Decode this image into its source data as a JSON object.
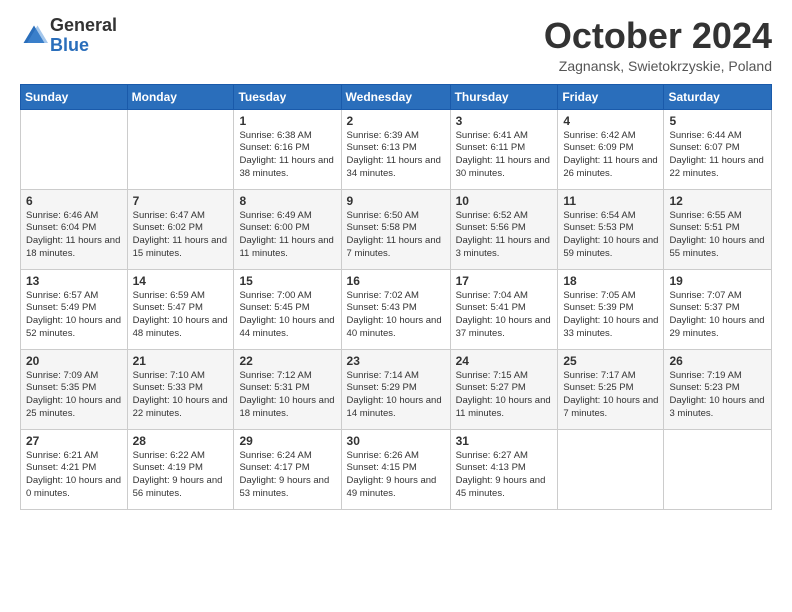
{
  "header": {
    "logo_general": "General",
    "logo_blue": "Blue",
    "month_title": "October 2024",
    "location": "Zagnansk, Swietokrzyskie, Poland"
  },
  "weekdays": [
    "Sunday",
    "Monday",
    "Tuesday",
    "Wednesday",
    "Thursday",
    "Friday",
    "Saturday"
  ],
  "weeks": [
    [
      {
        "day": "",
        "info": ""
      },
      {
        "day": "",
        "info": ""
      },
      {
        "day": "1",
        "info": "Sunrise: 6:38 AM\nSunset: 6:16 PM\nDaylight: 11 hours and 38 minutes."
      },
      {
        "day": "2",
        "info": "Sunrise: 6:39 AM\nSunset: 6:13 PM\nDaylight: 11 hours and 34 minutes."
      },
      {
        "day": "3",
        "info": "Sunrise: 6:41 AM\nSunset: 6:11 PM\nDaylight: 11 hours and 30 minutes."
      },
      {
        "day": "4",
        "info": "Sunrise: 6:42 AM\nSunset: 6:09 PM\nDaylight: 11 hours and 26 minutes."
      },
      {
        "day": "5",
        "info": "Sunrise: 6:44 AM\nSunset: 6:07 PM\nDaylight: 11 hours and 22 minutes."
      }
    ],
    [
      {
        "day": "6",
        "info": "Sunrise: 6:46 AM\nSunset: 6:04 PM\nDaylight: 11 hours and 18 minutes."
      },
      {
        "day": "7",
        "info": "Sunrise: 6:47 AM\nSunset: 6:02 PM\nDaylight: 11 hours and 15 minutes."
      },
      {
        "day": "8",
        "info": "Sunrise: 6:49 AM\nSunset: 6:00 PM\nDaylight: 11 hours and 11 minutes."
      },
      {
        "day": "9",
        "info": "Sunrise: 6:50 AM\nSunset: 5:58 PM\nDaylight: 11 hours and 7 minutes."
      },
      {
        "day": "10",
        "info": "Sunrise: 6:52 AM\nSunset: 5:56 PM\nDaylight: 11 hours and 3 minutes."
      },
      {
        "day": "11",
        "info": "Sunrise: 6:54 AM\nSunset: 5:53 PM\nDaylight: 10 hours and 59 minutes."
      },
      {
        "day": "12",
        "info": "Sunrise: 6:55 AM\nSunset: 5:51 PM\nDaylight: 10 hours and 55 minutes."
      }
    ],
    [
      {
        "day": "13",
        "info": "Sunrise: 6:57 AM\nSunset: 5:49 PM\nDaylight: 10 hours and 52 minutes."
      },
      {
        "day": "14",
        "info": "Sunrise: 6:59 AM\nSunset: 5:47 PM\nDaylight: 10 hours and 48 minutes."
      },
      {
        "day": "15",
        "info": "Sunrise: 7:00 AM\nSunset: 5:45 PM\nDaylight: 10 hours and 44 minutes."
      },
      {
        "day": "16",
        "info": "Sunrise: 7:02 AM\nSunset: 5:43 PM\nDaylight: 10 hours and 40 minutes."
      },
      {
        "day": "17",
        "info": "Sunrise: 7:04 AM\nSunset: 5:41 PM\nDaylight: 10 hours and 37 minutes."
      },
      {
        "day": "18",
        "info": "Sunrise: 7:05 AM\nSunset: 5:39 PM\nDaylight: 10 hours and 33 minutes."
      },
      {
        "day": "19",
        "info": "Sunrise: 7:07 AM\nSunset: 5:37 PM\nDaylight: 10 hours and 29 minutes."
      }
    ],
    [
      {
        "day": "20",
        "info": "Sunrise: 7:09 AM\nSunset: 5:35 PM\nDaylight: 10 hours and 25 minutes."
      },
      {
        "day": "21",
        "info": "Sunrise: 7:10 AM\nSunset: 5:33 PM\nDaylight: 10 hours and 22 minutes."
      },
      {
        "day": "22",
        "info": "Sunrise: 7:12 AM\nSunset: 5:31 PM\nDaylight: 10 hours and 18 minutes."
      },
      {
        "day": "23",
        "info": "Sunrise: 7:14 AM\nSunset: 5:29 PM\nDaylight: 10 hours and 14 minutes."
      },
      {
        "day": "24",
        "info": "Sunrise: 7:15 AM\nSunset: 5:27 PM\nDaylight: 10 hours and 11 minutes."
      },
      {
        "day": "25",
        "info": "Sunrise: 7:17 AM\nSunset: 5:25 PM\nDaylight: 10 hours and 7 minutes."
      },
      {
        "day": "26",
        "info": "Sunrise: 7:19 AM\nSunset: 5:23 PM\nDaylight: 10 hours and 3 minutes."
      }
    ],
    [
      {
        "day": "27",
        "info": "Sunrise: 6:21 AM\nSunset: 4:21 PM\nDaylight: 10 hours and 0 minutes."
      },
      {
        "day": "28",
        "info": "Sunrise: 6:22 AM\nSunset: 4:19 PM\nDaylight: 9 hours and 56 minutes."
      },
      {
        "day": "29",
        "info": "Sunrise: 6:24 AM\nSunset: 4:17 PM\nDaylight: 9 hours and 53 minutes."
      },
      {
        "day": "30",
        "info": "Sunrise: 6:26 AM\nSunset: 4:15 PM\nDaylight: 9 hours and 49 minutes."
      },
      {
        "day": "31",
        "info": "Sunrise: 6:27 AM\nSunset: 4:13 PM\nDaylight: 9 hours and 45 minutes."
      },
      {
        "day": "",
        "info": ""
      },
      {
        "day": "",
        "info": ""
      }
    ]
  ]
}
